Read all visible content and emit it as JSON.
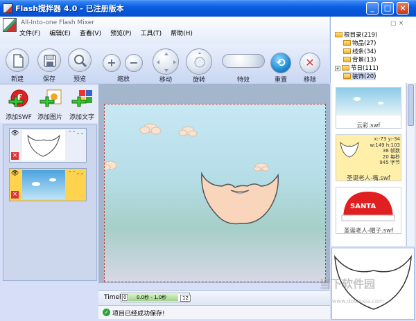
{
  "window": {
    "title": "Flash搅拌器 4.0 - 已注册版本",
    "subtitle": "All-Into-one Flash Mixer",
    "minimize": "_",
    "maximize": "□",
    "close": "×"
  },
  "menu": [
    "文件(F)",
    "编辑(E)",
    "查看(V)",
    "预览(P)",
    "工具(T)",
    "帮助(H)"
  ],
  "toolbar": {
    "new": "新建",
    "save": "保存",
    "preview": "预览",
    "zoom": "缩放",
    "move": "移动",
    "rotate": "旋转",
    "effects": "特效",
    "reset": "重置",
    "remove": "移除"
  },
  "tree": {
    "root": "根目录(219)",
    "items": [
      "物品(27)",
      "线条(34)",
      "背景(13)",
      "节日(111)",
      "装饰(20)"
    ]
  },
  "left_tools": {
    "add_swf": "添加SWF",
    "add_image": "添加图片",
    "add_text": "添加文字"
  },
  "thumbs": [
    {
      "caption": "云彩.swf"
    },
    {
      "caption": "圣诞老人-嘴.swf",
      "info": [
        "x:-73 y:-34",
        "w:149 h:103",
        "38 帧数",
        "20 每秒",
        "945 字节"
      ]
    },
    {
      "caption": "圣诞老人-帽子.swf",
      "hat_text": "SANTA"
    }
  ],
  "timeline": {
    "label": "Timel",
    "start": "0",
    "range": "0.0秒 - 1.0秒",
    "end": "12"
  },
  "status": "项目已经成功保存!",
  "watermark": {
    "line1": "当下软件园",
    "line2": "www.downxia.com"
  },
  "colors": {
    "titlebar": "#0553d9",
    "accent_red": "#d33",
    "layer_selected": "#ffd34d"
  }
}
